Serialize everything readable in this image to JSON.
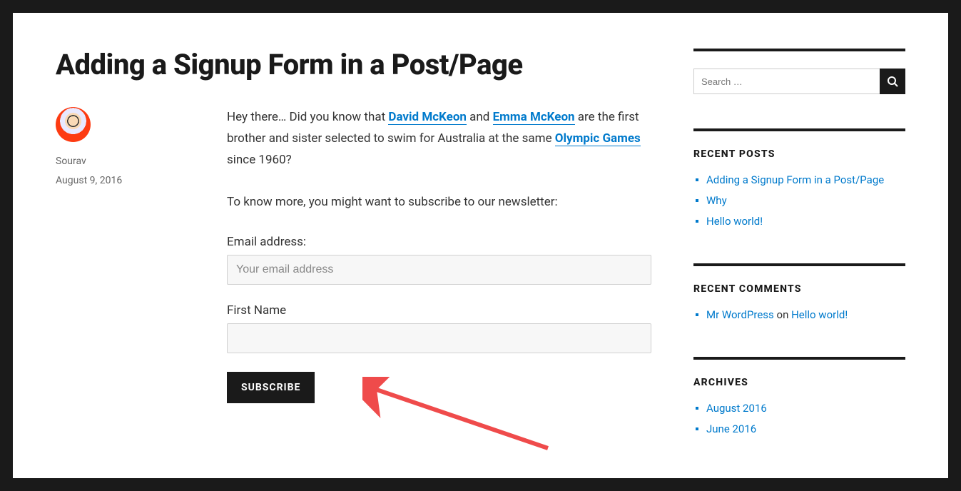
{
  "post": {
    "title": "Adding a Signup Form in a Post/Page",
    "author": "Sourav",
    "date": "August 9, 2016",
    "paragraph1_lead": "Hey there… Did you know that ",
    "link1": "David McKeon",
    "paragraph1_mid1": " and ",
    "link2": "Emma McKeon",
    "paragraph1_mid2": " are the first brother and sister selected to swim for Australia at the same ",
    "link3": "Olympic Games",
    "paragraph1_tail": " since 1960?",
    "paragraph2": "To know more, you might want to subscribe to our newsletter:"
  },
  "form": {
    "email_label": "Email address:",
    "email_placeholder": "Your email address",
    "firstname_label": "First Name",
    "subscribe_label": "SUBSCRIBE"
  },
  "sidebar": {
    "search_placeholder": "Search …",
    "recent_posts_title": "RECENT POSTS",
    "recent_posts": [
      "Adding a Signup Form in a Post/Page",
      "Why",
      "Hello world!"
    ],
    "recent_comments_title": "RECENT COMMENTS",
    "recent_comment_author": "Mr WordPress",
    "recent_comment_on": " on ",
    "recent_comment_post": "Hello world!",
    "archives_title": "ARCHIVES",
    "archives": [
      "August 2016",
      "June 2016"
    ]
  }
}
